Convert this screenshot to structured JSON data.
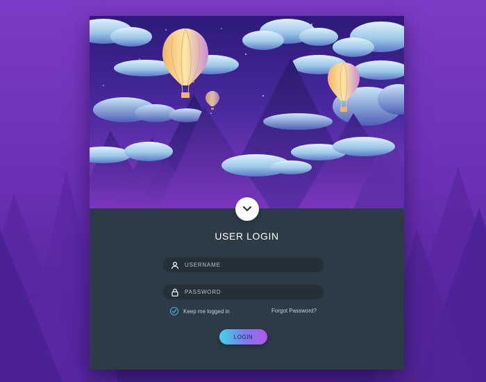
{
  "login": {
    "title": "USER LOGIN",
    "username": {
      "placeholder": "USERNAME",
      "value": "",
      "icon": "user-icon"
    },
    "password": {
      "placeholder": "PASSWORD",
      "value": "",
      "icon": "lock-icon"
    },
    "remember": {
      "label": "Keep me logged in",
      "checked": true
    },
    "forgot_label": "Forgot Password?",
    "submit_label": "LOGIN",
    "toggle_icon": "chevron-down-icon"
  },
  "colors": {
    "background": "#6b2fb5",
    "panel": "#2c3b46",
    "field": "#243039",
    "accent_start": "#3fd6e6",
    "accent_end": "#b755e8",
    "check": "#4ab3e6"
  }
}
